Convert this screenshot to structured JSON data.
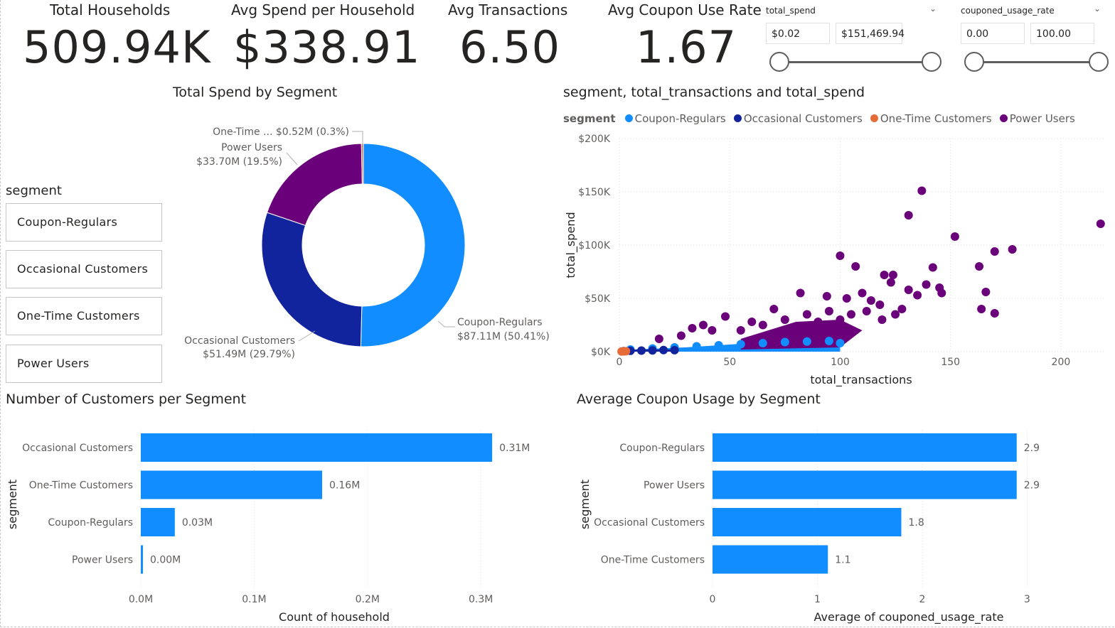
{
  "kpis": [
    {
      "title": "Total Households",
      "value": "509.94K"
    },
    {
      "title": "Avg Spend per Household",
      "value": "$338.91"
    },
    {
      "title": "Avg Transactions",
      "value": "6.50"
    },
    {
      "title": "Avg Coupon Use Rate",
      "value": "1.67"
    }
  ],
  "slicers": {
    "total_spend": {
      "label": "total_spend",
      "min": "$0.02",
      "max": "$151,469.94"
    },
    "couponed_usage_rate": {
      "label": "couponed_usage_rate",
      "min": "0.00",
      "max": "100.00"
    }
  },
  "segment_slicer": {
    "title": "segment",
    "items": [
      "Coupon-Regulars",
      "Occasional Customers",
      "One-Time Customers",
      "Power Users"
    ]
  },
  "colors": {
    "coupon_regulars": "#118DFF",
    "occasional": "#12239E",
    "one_time": "#E66C37",
    "power_users": "#6B007B",
    "bar": "#118DFF"
  },
  "donut": {
    "title": "Total Spend by Segment",
    "labels": {
      "one_time": "One-Time ... $0.52M (0.3%)",
      "power_name": "Power Users",
      "power_value": "$33.70M (19.5%)",
      "occ_name": "Occasional Customers",
      "occ_value": "$51.49M (29.79%)",
      "coupon_name": "Coupon-Regulars",
      "coupon_value": "$87.11M (50.41%)"
    }
  },
  "scatter": {
    "title": "segment, total_transactions and total_spend",
    "legend_title": "segment",
    "legend": [
      "Coupon-Regulars",
      "Occasional Customers",
      "One-Time Customers",
      "Power Users"
    ],
    "x_title": "total_transactions",
    "y_title": "total_spend",
    "x_ticks": [
      "0",
      "50",
      "100",
      "150",
      "200"
    ],
    "y_ticks": [
      "$0K",
      "$50K",
      "$100K",
      "$150K",
      "$200K"
    ]
  },
  "bar_customers": {
    "title": "Number of Customers per Segment",
    "y_title": "segment",
    "x_title": "Count of household",
    "x_ticks": [
      "0.0M",
      "0.1M",
      "0.2M",
      "0.3M"
    ],
    "labels": [
      "0.31M",
      "0.16M",
      "0.03M",
      "0.00M"
    ]
  },
  "bar_coupon": {
    "title": "Average Coupon Usage by Segment",
    "y_title": "segment",
    "x_title": "Average of couponed_usage_rate",
    "x_ticks": [
      "0",
      "1",
      "2",
      "3"
    ],
    "labels": [
      "2.9",
      "2.9",
      "1.8",
      "1.1"
    ]
  },
  "chart_data": [
    {
      "type": "pie",
      "title": "Total Spend by Segment",
      "categories": [
        "Coupon-Regulars",
        "Occasional Customers",
        "Power Users",
        "One-Time Customers"
      ],
      "values": [
        87.11,
        51.49,
        33.7,
        0.52
      ],
      "unit": "$M",
      "percent": [
        50.41,
        29.79,
        19.5,
        0.3
      ]
    },
    {
      "type": "scatter",
      "title": "segment, total_transactions and total_spend",
      "xlabel": "total_transactions",
      "ylabel": "total_spend",
      "xlim": [
        0,
        220
      ],
      "ylim": [
        0,
        200000
      ],
      "series": [
        {
          "name": "Power Users",
          "points": [
            [
              137,
              151000
            ],
            [
              131,
              128000
            ],
            [
              152,
              108000
            ],
            [
              218,
              120000
            ],
            [
              228,
              118000
            ],
            [
              178,
              96000
            ],
            [
              170,
              94000
            ],
            [
              100,
              90000
            ],
            [
              107,
              80000
            ],
            [
              163,
              80000
            ],
            [
              142,
              79000
            ],
            [
              139,
              63000
            ],
            [
              120,
              72000
            ],
            [
              124,
              72000
            ],
            [
              123,
              65000
            ],
            [
              166,
              56000
            ],
            [
              146,
              55000
            ],
            [
              135,
              53000
            ],
            [
              131,
              58000
            ],
            [
              145,
              60000
            ],
            [
              164,
              40000
            ],
            [
              170,
              36000
            ],
            [
              82,
              55000
            ],
            [
              94,
              52000
            ],
            [
              110,
              55000
            ],
            [
              103,
              50000
            ],
            [
              114,
              48000
            ],
            [
              118,
              44000
            ],
            [
              128,
              40000
            ],
            [
              70,
              40000
            ],
            [
              48,
              33000
            ],
            [
              38,
              25000
            ],
            [
              33,
              22000
            ],
            [
              42,
              20000
            ],
            [
              18,
              12000
            ],
            [
              28,
              15000
            ],
            [
              60,
              28000
            ],
            [
              75,
              30000
            ],
            [
              85,
              35000
            ],
            [
              95,
              38000
            ],
            [
              65,
              25000
            ],
            [
              55,
              20000
            ],
            [
              80,
              22000
            ],
            [
              90,
              28000
            ],
            [
              100,
              30000
            ],
            [
              105,
              35000
            ],
            [
              112,
              38000
            ],
            [
              119,
              30000
            ],
            [
              125,
              35000
            ]
          ]
        },
        {
          "name": "Coupon-Regulars",
          "points": [
            [
              5,
              2000
            ],
            [
              15,
              3000
            ],
            [
              25,
              4000
            ],
            [
              35,
              5000
            ],
            [
              45,
              6000
            ],
            [
              55,
              7000
            ],
            [
              65,
              8000
            ],
            [
              75,
              9000
            ],
            [
              85,
              9500
            ],
            [
              95,
              10000
            ],
            [
              100,
              8000
            ]
          ]
        },
        {
          "name": "Occasional Customers",
          "points": [
            [
              2,
              500
            ],
            [
              5,
              800
            ],
            [
              10,
              1000
            ],
            [
              15,
              1200
            ],
            [
              20,
              1500
            ],
            [
              25,
              1400
            ]
          ]
        },
        {
          "name": "One-Time Customers",
          "points": [
            [
              1,
              200
            ],
            [
              2,
              300
            ],
            [
              3,
              400
            ]
          ]
        }
      ]
    },
    {
      "type": "bar",
      "orientation": "horizontal",
      "title": "Number of Customers per Segment",
      "categories": [
        "Occasional Customers",
        "One-Time Customers",
        "Coupon-Regulars",
        "Power Users"
      ],
      "values": [
        0.31,
        0.16,
        0.03,
        0.0
      ],
      "unit": "M",
      "xlabel": "Count of household",
      "ylabel": "segment",
      "xlim": [
        0,
        0.33
      ]
    },
    {
      "type": "bar",
      "orientation": "horizontal",
      "title": "Average Coupon Usage by Segment",
      "categories": [
        "Coupon-Regulars",
        "Power Users",
        "Occasional Customers",
        "One-Time Customers"
      ],
      "values": [
        2.9,
        2.9,
        1.8,
        1.1
      ],
      "xlabel": "Average of couponed_usage_rate",
      "ylabel": "segment",
      "xlim": [
        0,
        3.2
      ]
    }
  ]
}
